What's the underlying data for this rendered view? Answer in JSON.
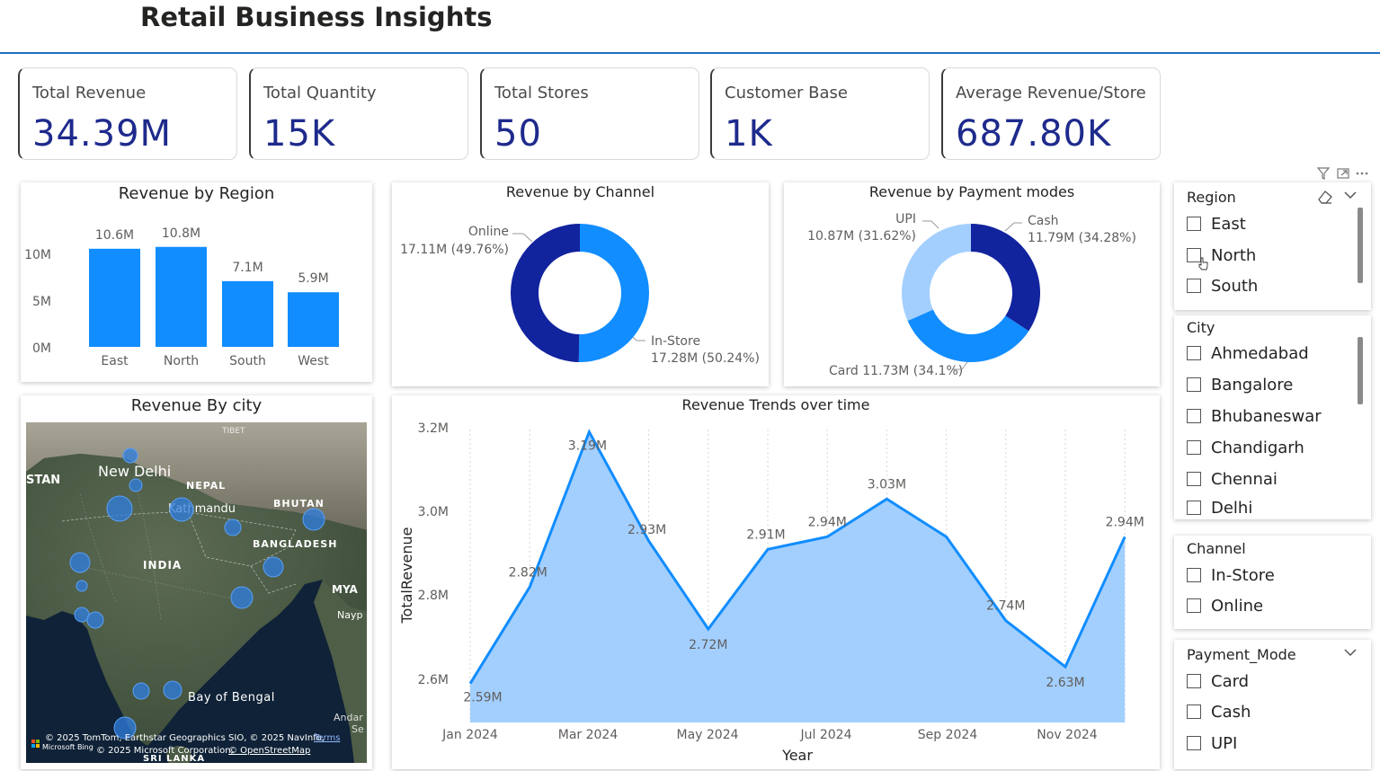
{
  "page": {
    "title": "Retail Business Insights"
  },
  "kpis": [
    {
      "label": "Total Revenue",
      "value": "34.39M"
    },
    {
      "label": "Total Quantity",
      "value": "15K"
    },
    {
      "label": "Total Stores",
      "value": "50"
    },
    {
      "label": "Customer Base",
      "value": "1K"
    },
    {
      "label": "Average Revenue/Store",
      "value": "687.80K"
    }
  ],
  "filter_icons": [
    "filter-icon",
    "focus-mode-icon",
    "more-options-icon"
  ],
  "charts": {
    "region": {
      "title": "Revenue by Region",
      "y_ticks": [
        "10M",
        "5M",
        "0M"
      ],
      "bar_color": "#118dff"
    },
    "channel": {
      "title": "Revenue by Channel",
      "labels": [
        {
          "name": "Online",
          "value": "17.11M (49.76%)"
        },
        {
          "name": "In-Store",
          "value": "17.28M (50.24%)"
        }
      ]
    },
    "payment": {
      "title": "Revenue by Payment modes",
      "labels": [
        {
          "name": "UPI",
          "value": "10.87M (31.62%)"
        },
        {
          "name": "Cash",
          "value": "11.79M (34.28%)"
        },
        {
          "name": "Card",
          "value": "Card 11.73M (34.1%)"
        }
      ]
    },
    "map": {
      "title": "Revenue By city",
      "place_labels": [
        "New Delhi",
        "NEPAL",
        "Kathmandu",
        "BHUTAN",
        "BANGLADESH",
        "INDIA",
        "MYA",
        "Nayp",
        "TIBET",
        "STAN",
        "Bay of Bengal",
        "Andar",
        "Se",
        "SRI LANKA"
      ],
      "attribution": "© 2025 TomTom, Earthstar Geographics SIO, © 2025 NavInfo,",
      "attribution2": "© 2025 Microsoft Corporation,",
      "terms_link": "Terms",
      "osm_link": "© OpenStreetMap",
      "bing_label": "Microsoft Bing"
    },
    "trend": {
      "title": "Revenue Trends over time",
      "ylabel": "TotalRevenue",
      "xlabel": "Year",
      "y_ticks": [
        "3.2M",
        "3.0M",
        "2.8M",
        "2.6M"
      ],
      "x_ticks": [
        "Jan 2024",
        "Mar 2024",
        "May 2024",
        "Jul 2024",
        "Sep 2024",
        "Nov 2024"
      ]
    }
  },
  "chart_data": [
    {
      "type": "bar",
      "title": "Revenue by Region",
      "categories": [
        "East",
        "North",
        "South",
        "West"
      ],
      "values": [
        10.6,
        10.8,
        7.1,
        5.9
      ],
      "data_labels": [
        "10.6M",
        "10.8M",
        "7.1M",
        "5.9M"
      ],
      "unit": "M",
      "ylim": [
        0,
        12
      ]
    },
    {
      "type": "pie",
      "title": "Revenue by Channel",
      "categories": [
        "In-Store",
        "Online"
      ],
      "values": [
        17.28,
        17.11
      ],
      "colors": [
        "#118dff",
        "#12239e"
      ]
    },
    {
      "type": "pie",
      "title": "Revenue by Payment modes",
      "categories": [
        "Cash",
        "Card",
        "UPI"
      ],
      "values": [
        11.79,
        11.73,
        10.87
      ],
      "colors": [
        "#12239e",
        "#118dff",
        "#a3cfff"
      ]
    },
    {
      "type": "area",
      "title": "Revenue Trends over time",
      "xlabel": "Year",
      "ylabel": "TotalRevenue",
      "x": [
        "Jan 2024",
        "Feb 2024",
        "Mar 2024",
        "Apr 2024",
        "May 2024",
        "Jun 2024",
        "Jul 2024",
        "Aug 2024",
        "Sep 2024",
        "Oct 2024",
        "Nov 2024",
        "Dec 2024"
      ],
      "values": [
        2.59,
        2.82,
        3.19,
        2.93,
        2.72,
        2.91,
        2.94,
        3.03,
        2.94,
        2.74,
        2.63,
        2.94
      ],
      "data_labels": [
        "2.59M",
        "2.82M",
        "3.19M",
        "2.93M",
        "2.72M",
        "2.91M",
        "2.94M",
        "3.03M",
        "",
        "2.74M",
        "2.63M",
        "2.94M"
      ],
      "ylim": [
        2.53,
        3.21
      ],
      "line_color": "#118dff",
      "fill_color": "#a3cfff"
    }
  ],
  "slicers": {
    "region": {
      "title": "Region",
      "items": [
        "East",
        "North",
        "South"
      ]
    },
    "city": {
      "title": "City",
      "items": [
        "Ahmedabad",
        "Bangalore",
        "Bhubaneswar",
        "Chandigarh",
        "Chennai",
        "Delhi"
      ]
    },
    "channel": {
      "title": "Channel",
      "items": [
        "In-Store",
        "Online"
      ]
    },
    "payment": {
      "title": "Payment_Mode",
      "items": [
        "Card",
        "Cash",
        "UPI"
      ]
    }
  }
}
